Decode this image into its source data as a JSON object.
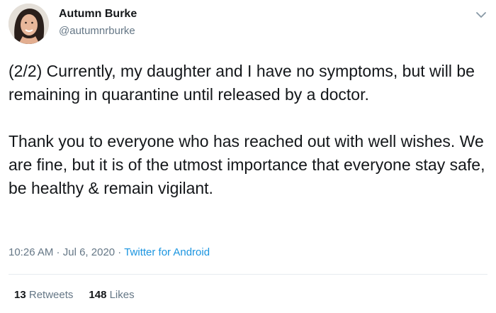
{
  "author": {
    "display_name": "Autumn Burke",
    "handle": "@autumnrburke"
  },
  "tweet": {
    "paragraphs": [
      "(2/2) Currently, my daughter and I have no symptoms, but will be remaining in quarantine until released by a doctor.",
      "Thank you to everyone who has reached out with well wishes. We are fine, but it is of the utmost importance that everyone stay safe, be healthy & remain vigilant."
    ]
  },
  "meta": {
    "time": "10:26 AM",
    "separator_1": " · ",
    "date": "Jul 6, 2020",
    "separator_2": " · ",
    "source": "Twitter for Android"
  },
  "stats": {
    "retweets_count": "13",
    "retweets_label": "Retweets",
    "likes_count": "148",
    "likes_label": "Likes"
  },
  "icons": {
    "menu": "chevron-down-icon"
  }
}
